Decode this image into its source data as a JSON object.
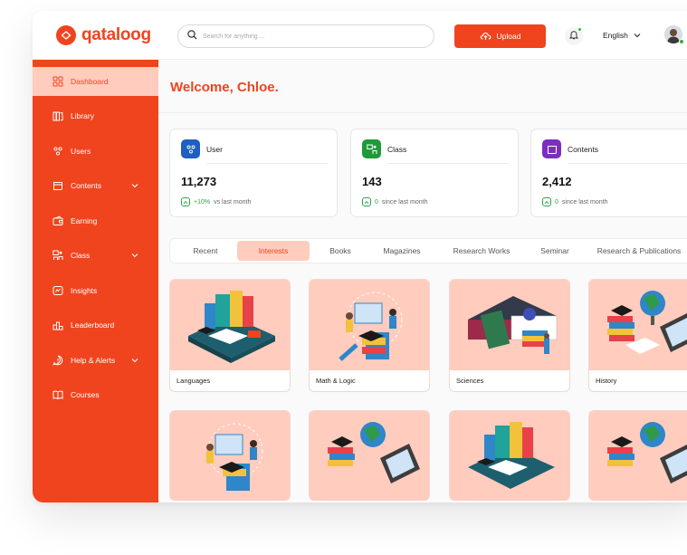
{
  "brand": {
    "name": "qataloog",
    "accent": "#f0441e",
    "accent_light": "#ffccbe"
  },
  "header": {
    "search_placeholder": "Search for anything ...",
    "upload_label": "Upload",
    "language": "English",
    "icons": [
      "search-icon",
      "upload-cloud-icon",
      "bell-icon",
      "chevron-down-icon",
      "avatar"
    ]
  },
  "sidebar": {
    "items": [
      {
        "label": "Dashboard",
        "icon": "dashboard-icon",
        "active": true
      },
      {
        "label": "Library",
        "icon": "library-icon"
      },
      {
        "label": "Users",
        "icon": "users-icon"
      },
      {
        "label": "Contents",
        "icon": "contents-icon",
        "expandable": true
      },
      {
        "label": "Earning",
        "icon": "wallet-icon"
      },
      {
        "label": "Class",
        "icon": "class-icon",
        "expandable": true
      },
      {
        "label": "Insights",
        "icon": "insights-icon"
      },
      {
        "label": "Leaderboard",
        "icon": "leaderboard-icon"
      },
      {
        "label": "Help & Alerts",
        "icon": "help-icon",
        "expandable": true
      },
      {
        "label": "Courses",
        "icon": "courses-icon"
      }
    ]
  },
  "main": {
    "welcome": "Welcome, Chloe.",
    "stats": [
      {
        "label": "User",
        "value": "11,273",
        "change": "+10%",
        "change_text": "vs last month",
        "color": "#1f5fbf"
      },
      {
        "label": "Class",
        "value": "143",
        "change": "0",
        "change_text": "since last month",
        "color": "#1f9a3a"
      },
      {
        "label": "Contents",
        "value": "2,412",
        "change": "0",
        "change_text": "since last month",
        "color": "#7b2fbe"
      }
    ],
    "tabs": [
      "Recent",
      "Interests",
      "Books",
      "Magazines",
      "Research Works",
      "Seminar",
      "Research & Publications"
    ],
    "active_tab": "Interests",
    "cards": [
      {
        "caption": "Languages"
      },
      {
        "caption": "Math & Logic"
      },
      {
        "caption": "Sciences"
      },
      {
        "caption": "History"
      }
    ]
  }
}
